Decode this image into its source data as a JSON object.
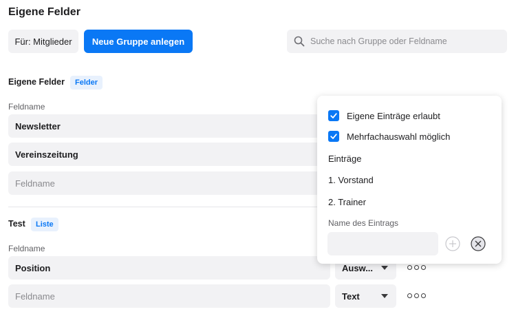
{
  "page": {
    "title": "Eigene Felder"
  },
  "toolbar": {
    "filter_label": "Für: Mitglieder",
    "new_group_label": "Neue Gruppe anlegen",
    "search_placeholder": "Suche nach Gruppe oder Feldname"
  },
  "groups": [
    {
      "title": "Eigene Felder",
      "badge": "Felder",
      "column_label": "Feldname",
      "fields": [
        {
          "value": "Newsletter"
        },
        {
          "value": "Vereinszeitung"
        }
      ],
      "new_field_placeholder": "Feldname"
    },
    {
      "title": "Test",
      "badge": "Liste",
      "column_label": "Feldname",
      "fields": [
        {
          "value": "Position",
          "type": "Ausw..."
        }
      ],
      "new_field_placeholder": "Feldname",
      "new_field_type": "Text"
    }
  ],
  "popover": {
    "own_entries_label": "Eigene Einträge erlaubt",
    "own_entries_checked": true,
    "multi_select_label": "Mehrfachauswahl möglich",
    "multi_select_checked": true,
    "entries_heading": "Einträge",
    "entries": [
      "1. Vorstand",
      "2. Trainer"
    ],
    "entry_name_label": "Name des Eintrags",
    "entry_name_value": ""
  },
  "icons": {
    "search": "search-icon",
    "check": "check-icon",
    "add": "plus-circle-icon",
    "remove": "close-circle-icon",
    "more": "more-horizontal-icon",
    "dropdown": "chevron-down-icon"
  },
  "colors": {
    "accent": "#0a78f5",
    "badge_bg": "#e8f1fd",
    "field_bg": "#f2f2f4"
  }
}
